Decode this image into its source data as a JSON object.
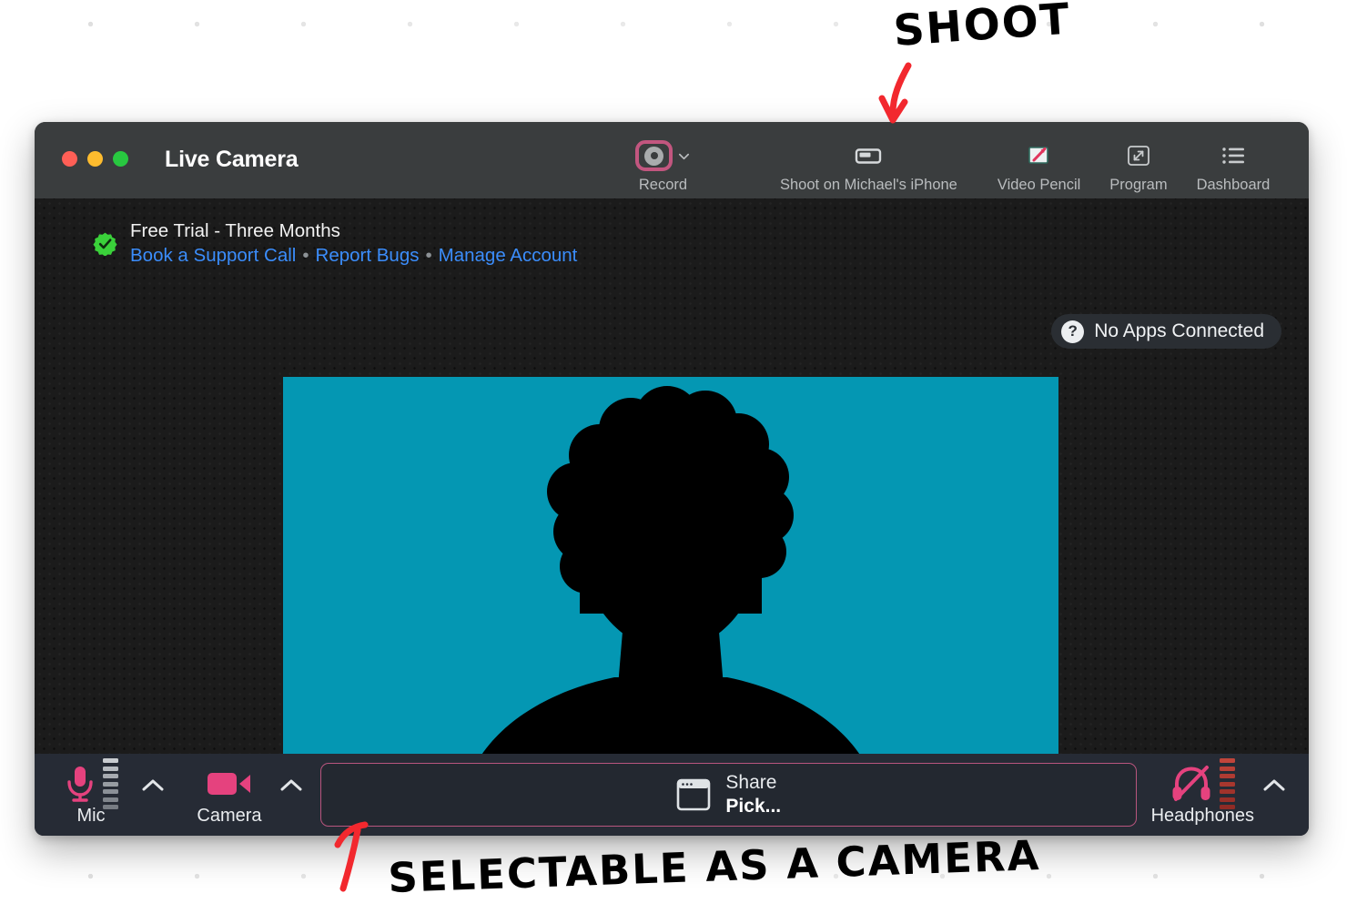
{
  "window": {
    "title": "Live Camera",
    "traffic_lights": [
      "close-red",
      "minimize-yellow",
      "maximize-green"
    ]
  },
  "toolbar": {
    "items": [
      {
        "label": "Record",
        "icon": "record-circle-icon",
        "has_chevron": true,
        "active": true
      },
      {
        "label": "Shoot on Michael's iPhone",
        "icon": "iphone-landscape-icon",
        "has_chevron": false,
        "active": false
      },
      {
        "label": "Video Pencil",
        "icon": "video-pencil-icon",
        "has_chevron": false,
        "active": false
      },
      {
        "label": "Program",
        "icon": "expand-arrows-icon",
        "has_chevron": false,
        "active": false
      },
      {
        "label": "Dashboard",
        "icon": "list-dashboard-icon",
        "has_chevron": false,
        "active": false
      }
    ]
  },
  "banner": {
    "badge_icon": "green-verified-seal-icon",
    "title": "Free Trial - Three Months",
    "links": [
      "Book a Support Call",
      "Report Bugs",
      "Manage Account"
    ],
    "separator": "•"
  },
  "apps_status": {
    "icon": "question-mark-icon",
    "label": "No Apps Connected"
  },
  "preview": {
    "background_color": "#0497b3",
    "silhouette_color": "#000000",
    "subject": "person-silhouette-avatar"
  },
  "controls": {
    "mic": {
      "label": "Mic",
      "icon": "microphone-icon",
      "meter_color": "#9aa0a6",
      "icon_color": "#e5427e"
    },
    "camera": {
      "label": "Camera",
      "icon": "camcorder-icon",
      "icon_color": "#e5427e"
    },
    "share": {
      "title": "Share",
      "value": "Pick...",
      "icon": "window-share-icon",
      "border_color": "#b8557e"
    },
    "headphones": {
      "label": "Headphones",
      "icon": "headphones-muted-icon",
      "meter_color": "#c4443a",
      "icon_color": "#e5427e"
    },
    "chevron_icon": "chevron-up-icon"
  },
  "annotations": {
    "color": "#f2282e",
    "top": {
      "text": "SHOOT",
      "arrow": "curved-arrow-down-left"
    },
    "bottom": {
      "text": "SELECTABLE AS A CAMERA",
      "arrow": "arrow-up-left"
    }
  },
  "colors": {
    "titlebar_bg": "#3a3d3e",
    "content_bg": "#1b1b1b",
    "bottombar_bg": "#262b35",
    "accent_pink": "#c2567f",
    "link_blue": "#3b8dfb",
    "badge_green": "#3ad13a"
  }
}
